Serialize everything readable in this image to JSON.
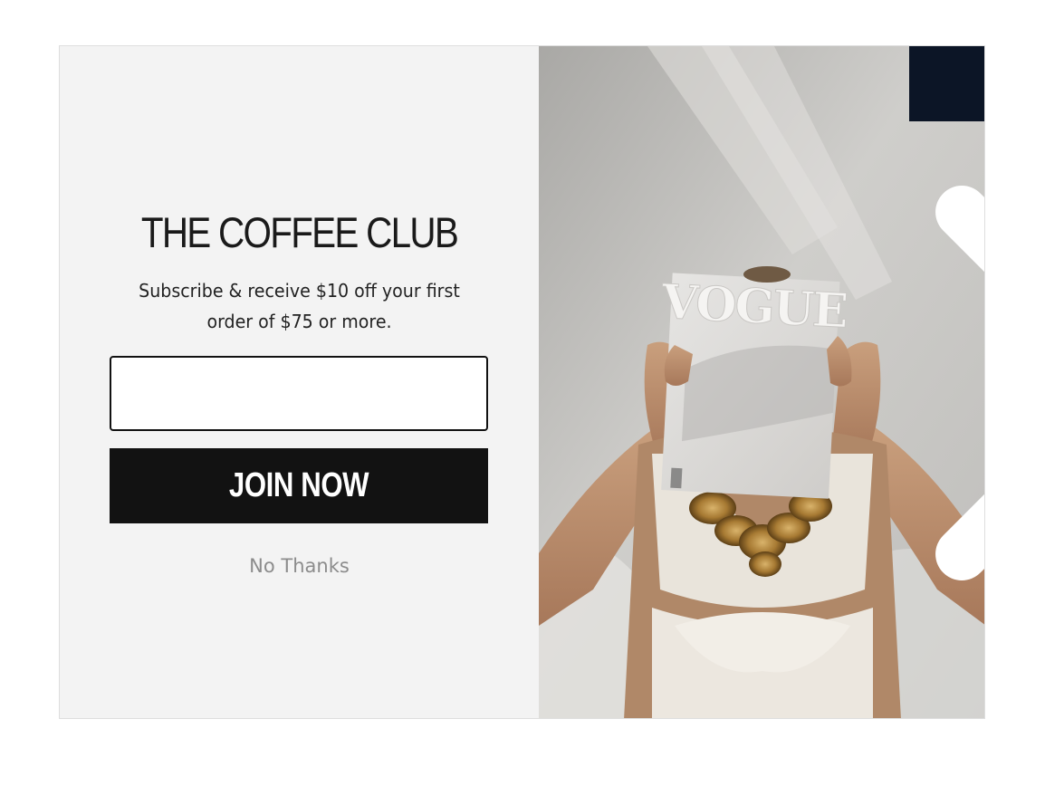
{
  "popup": {
    "title": "THE COFFEE CLUB",
    "subtitle": "Subscribe & receive $10 off your first order of $75 or more.",
    "email_placeholder": "",
    "join_label": "JOIN NOW",
    "decline_label": "No Thanks",
    "close_icon": "close-icon",
    "image_text": "VOGUE"
  },
  "colors": {
    "panel_bg": "#f3f3f3",
    "button_bg": "#121212",
    "close_bg": "#0c1526",
    "muted_text": "#8c8c8c"
  }
}
